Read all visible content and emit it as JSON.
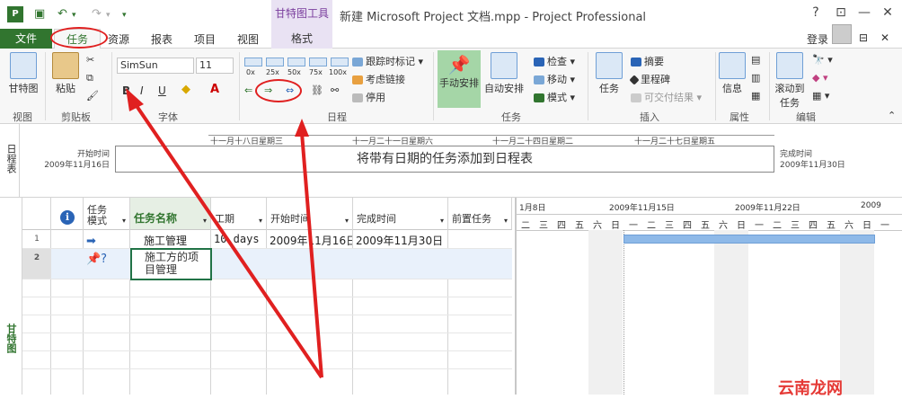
{
  "titlebar": {
    "app_icon": "P",
    "context_tab": "甘特图工具",
    "window_title": "新建 Microsoft Project 文档.mpp - Project Professional",
    "help": "?",
    "minimize": "—",
    "restore": "▭",
    "close": "✕",
    "qat_icons": [
      "save-icon",
      "undo-icon",
      "redo-icon",
      "customize-icon"
    ]
  },
  "tabs": {
    "file": "文件",
    "task": "任务",
    "resource": "资源",
    "report": "报表",
    "project": "项目",
    "view": "视图",
    "format": "格式",
    "login": "登录",
    "restore_ribbon": "⊟",
    "close_doc": "✕"
  },
  "ribbon": {
    "view_group": {
      "label": "视图",
      "gantt_button": "甘特图"
    },
    "clipboard_group": {
      "label": "剪贴板",
      "paste": "粘贴"
    },
    "font_group": {
      "label": "字体",
      "font_name": "SimSun",
      "font_size": "11",
      "bold": "B",
      "italic": "I",
      "underline": "U"
    },
    "schedule_group": {
      "label": "日程",
      "percents": [
        "0x",
        "25x",
        "50x",
        "75x",
        "100x"
      ],
      "mark_on_track": "跟踪时标记",
      "respect_links": "考虑链接",
      "inactivate": "停用"
    },
    "tasks_group": {
      "label": "任务",
      "manual": "手动安排",
      "auto": "自动安排",
      "inspect": "检查",
      "move": "移动",
      "mode": "模式"
    },
    "insert_group": {
      "label": "插入",
      "task": "任务",
      "summary": "摘要",
      "milestone": "里程碑",
      "deliverable": "可交付结果"
    },
    "properties_group": {
      "label": "属性",
      "info": "信息"
    },
    "editing_group": {
      "label": "编辑",
      "scroll_to_task": "滚动到任务"
    }
  },
  "timeline": {
    "side_label": "日程表",
    "start_label": "开始时间",
    "start_date": "2009年11月16日",
    "finish_label": "完成时间",
    "finish_date": "2009年11月30日",
    "ticks": [
      "十一月十八日星期三",
      "十一月二十一日星期六",
      "十一月二十四日星期二",
      "十一月二十七日星期五"
    ],
    "placeholder": "将带有日期的任务添加到日程表"
  },
  "gantt": {
    "side_label": "甘特图",
    "columns": {
      "info": "ℹ",
      "mode": "任务模式",
      "name": "任务名称",
      "duration": "工期",
      "start": "开始时间",
      "finish": "完成时间",
      "predecessors": "前置任务"
    },
    "rows": [
      {
        "num": "1",
        "name": "施工管理",
        "duration": "10 days",
        "start": "2009年11月16日",
        "finish": "2009年11月30日"
      },
      {
        "num": "2",
        "name_line1": "施工方的项",
        "name_line2": "目管理"
      }
    ],
    "weeks": [
      "1月8日",
      "2009年11月15日",
      "2009年11月22日",
      "2009"
    ],
    "days": [
      "二",
      "三",
      "四",
      "五",
      "六",
      "日",
      "一",
      "二",
      "三",
      "四",
      "五",
      "六",
      "日",
      "一",
      "二",
      "三",
      "四",
      "五",
      "六",
      "日",
      "一"
    ]
  },
  "watermark": "云南龙网",
  "colors": {
    "brand": "#31752f",
    "context": "#7a3e9d",
    "bar": "#8eb9e8",
    "annotation": "#e02020"
  }
}
